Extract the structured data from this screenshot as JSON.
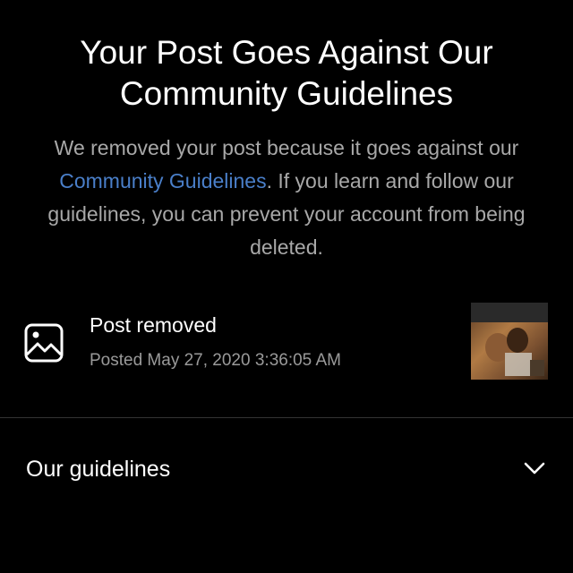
{
  "header": {
    "title": "Your Post Goes Against Our Community Guidelines"
  },
  "description": {
    "before_link": "We removed your post because it goes against our ",
    "link_text": "Community Guidelines",
    "after_link": ". If you learn and follow our guidelines, you can prevent your account from being deleted."
  },
  "post": {
    "icon": "image-icon",
    "title": "Post removed",
    "date": "Posted May 27, 2020 3:36:05 AM"
  },
  "guidelines": {
    "label": "Our guidelines",
    "icon": "chevron-down-icon"
  },
  "colors": {
    "background": "#000000",
    "text": "#ffffff",
    "secondary_text": "#a8a8a8",
    "link": "#4a7fc9",
    "divider": "#333333"
  }
}
